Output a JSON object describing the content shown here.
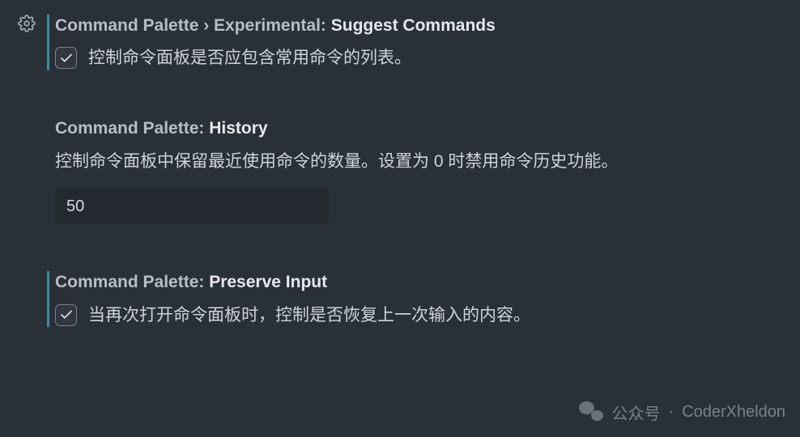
{
  "settings": {
    "suggest_commands": {
      "category": "Command Palette › Experimental: ",
      "title": "Suggest Commands",
      "checked": true,
      "description": "控制命令面板是否应包含常用命令的列表。"
    },
    "history": {
      "category": "Command Palette: ",
      "title": "History",
      "description": "控制命令面板中保留最近使用命令的数量。设置为 0 时禁用命令历史功能。",
      "value": "50"
    },
    "preserve_input": {
      "category": "Command Palette: ",
      "title": "Preserve Input",
      "checked": true,
      "description": "当再次打开命令面板时，控制是否恢复上一次输入的内容。"
    }
  },
  "watermark": {
    "label": "公众号",
    "sep": "·",
    "name": "CoderXheldon"
  }
}
